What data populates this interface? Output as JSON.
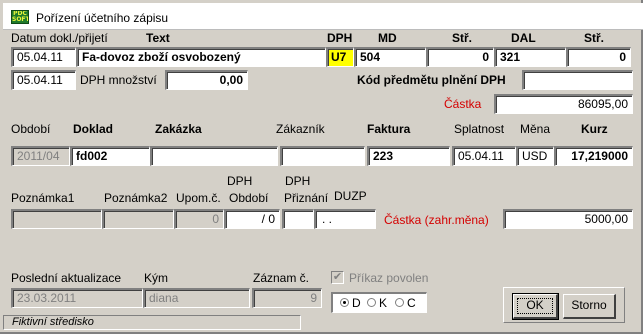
{
  "window": {
    "title": "Pořízení účetního zápisu"
  },
  "header_labels": {
    "datum": "Datum dokl./přijetí",
    "text": "Text",
    "dph": "DPH",
    "md": "MD",
    "str1": "Stř.",
    "dal": "DAL",
    "str2": "Stř."
  },
  "row1": {
    "datum": "05.04.11",
    "text": "Fa-dovoz zboží osvobozený",
    "dph": "U7",
    "md": "504",
    "str_md": "0",
    "dal": "321",
    "str_dal": "0"
  },
  "row2": {
    "datum2": "05.04.11",
    "dph_mnozstvi_label": "DPH množství",
    "dph_mnozstvi": "0,00",
    "kod_label": "Kód předmětu plnění DPH",
    "kod_value": ""
  },
  "castka": {
    "label": "Částka",
    "value": "86095,00"
  },
  "row3_labels": {
    "obdobi": "Období",
    "doklad": "Doklad",
    "zakazka": "Zakázka",
    "zakaznik": "Zákazník",
    "faktura": "Faktura",
    "splatnost": "Splatnost",
    "mena": "Měna",
    "kurz": "Kurz"
  },
  "row3": {
    "obdobi": "2011/04",
    "doklad": "fd002",
    "zakazka": "",
    "zakaznik": "",
    "faktura": "223",
    "splatnost": "05.04.11",
    "mena": "USD",
    "kurz": "17,219000"
  },
  "row4_labels": {
    "poznamka1": "Poznámka1",
    "poznamka2": "Poznámka2",
    "upom": "Upom.č.",
    "dph_obdobi_top": "DPH",
    "dph_obdobi_bottom": "Období",
    "dph_priznani_top": "DPH",
    "dph_priznani_bottom": "Přiznání",
    "duzp": "DUZP"
  },
  "row4": {
    "poznamka1": "",
    "poznamka2": "",
    "upom": "0",
    "dph_obdobi": "/ 0",
    "dph_priznani": "",
    "duzp": ". ."
  },
  "castka_zahr": {
    "label": "Částka (zahr.měna)",
    "value": "5000,00"
  },
  "footer_labels": {
    "posledni": "Poslední aktualizace",
    "kym": "Kým",
    "zaznam": "Záznam č.",
    "prikaz": "Příkaz povolen"
  },
  "footer": {
    "posledni": "23.03.2011",
    "kym": "diana",
    "zaznam": "9",
    "prikaz_checked": true
  },
  "radio": {
    "options": [
      "D",
      "K",
      "C"
    ],
    "selected": "D"
  },
  "buttons": {
    "ok": "OK",
    "storno": "Storno"
  },
  "status": {
    "text": "Fiktivní středisko"
  }
}
